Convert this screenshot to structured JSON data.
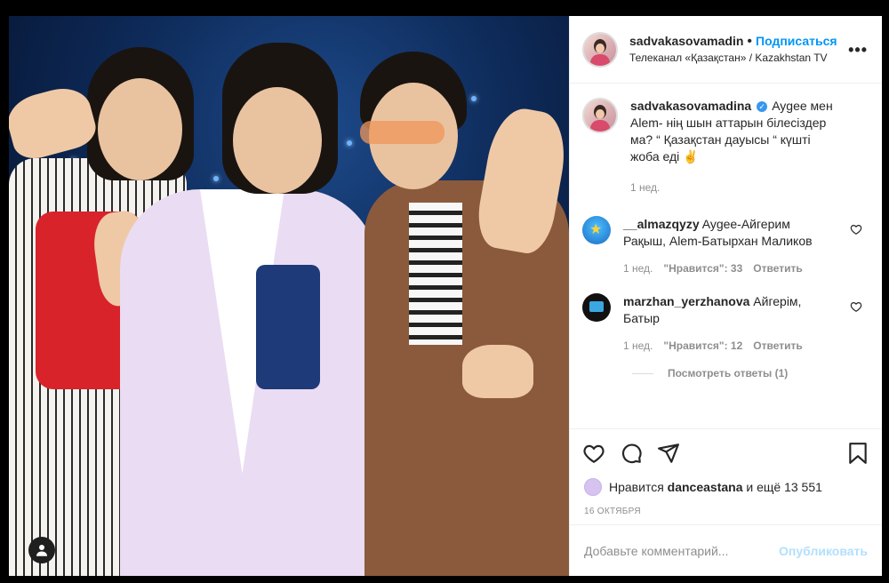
{
  "header": {
    "username": "sadvakasovamadin",
    "follow_label": "Подписаться",
    "location": "Телеканал «Қазақстан» / Kazakhstan TV"
  },
  "caption": {
    "username": "sadvakasovamadina",
    "text": "Aygee мен Alem- нің шын аттарын білесіздер ма? “ Қазақстан дауысы “ күшті жоба еді ✌️",
    "time": "1 нед."
  },
  "comments": [
    {
      "username": "__almazqyzy",
      "text": "Aygee-Айгерим Рақыш, Alem-Батырхан Маликов",
      "time": "1 нед.",
      "likes": "\"Нравится\": 33",
      "reply": "Ответить"
    },
    {
      "username": "marzhan_yerzhanova",
      "text": "Айгерім, Батыр",
      "time": "1 нед.",
      "likes": "\"Нравится\": 12",
      "reply": "Ответить"
    }
  ],
  "view_replies": "Посмотреть ответы (1)",
  "likes": {
    "prefix": "Нравится",
    "user": "danceastana",
    "suffix": "и ещё 13 551"
  },
  "date": "16 ОКТЯБРЯ",
  "comment_input": {
    "placeholder": "Добавьте комментарий...",
    "publish": "Опубликовать"
  }
}
